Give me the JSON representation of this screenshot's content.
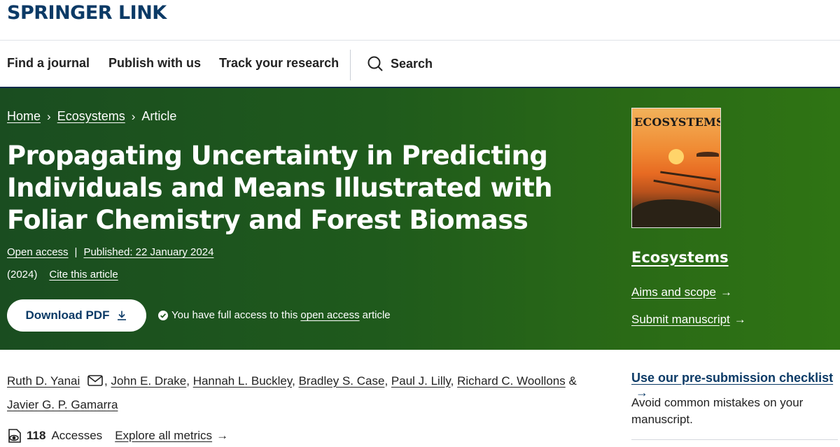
{
  "header": {
    "logo_text": "SPRINGER LINK"
  },
  "nav": {
    "items": [
      "Find a journal",
      "Publish with us",
      "Track your research"
    ],
    "search_label": "Search"
  },
  "breadcrumb": {
    "home": "Home",
    "journal": "Ecosystems",
    "current": "Article"
  },
  "article": {
    "title": "Propagating Uncertainty in Predicting Individuals and Means Illustrated with Foliar Chemistry and Forest Biomass",
    "open_access": "Open access",
    "published": "Published: 22 January 2024",
    "year": "(2024)",
    "cite": "Cite this article",
    "download_label": "Download PDF",
    "access_prefix": "You have full access to this",
    "access_link": "open access",
    "access_suffix": "article"
  },
  "journal_panel": {
    "cover_title": "ECOSYSTEMS",
    "name": "Ecosystems",
    "aims_scope": "Aims and scope",
    "submit": "Submit manuscript",
    "arrow": "→"
  },
  "authors": [
    "Ruth D. Yanai",
    "John E. Drake",
    "Hannah L. Buckley",
    "Bradley S. Case",
    "Paul J. Lilly",
    "Richard C. Woollons",
    "Javier G. P. Gamarra"
  ],
  "author_separators": {
    "comma": ",",
    "ampersand": "&"
  },
  "metrics": {
    "accesses_count": "118",
    "accesses_label": "Accesses",
    "explore": "Explore all metrics",
    "arrow": "→"
  },
  "sidebar": {
    "checklist_link": "Use our pre-submission checklist",
    "checklist_arrow": "→",
    "checklist_text": "Avoid common mistakes on your manuscript."
  },
  "colors": {
    "brand_navy": "#0b3a66",
    "hero_green_start": "#1a4d20",
    "hero_green_end": "#2f7414"
  },
  "icons": [
    "search-icon",
    "download-icon",
    "check-circle-icon",
    "mail-icon",
    "eye-icon",
    "arrow-right-icon"
  ]
}
